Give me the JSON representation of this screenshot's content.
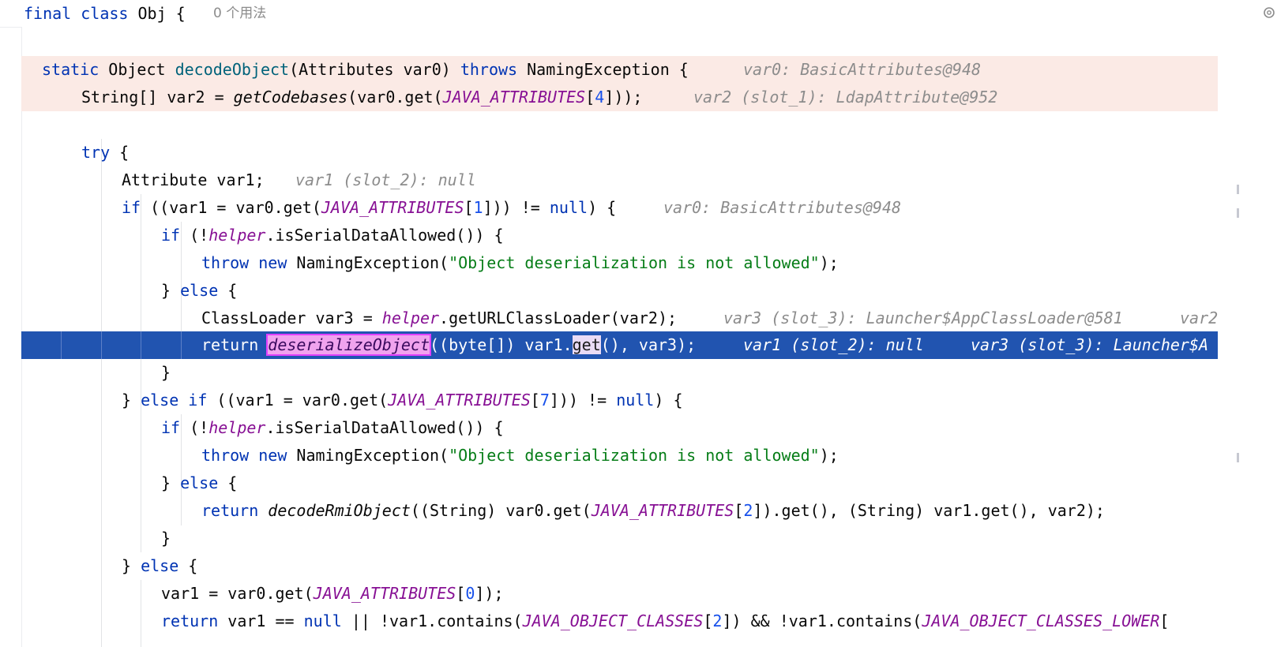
{
  "header": {
    "class_decl": "final class Obj {",
    "usages": "0 个用法"
  },
  "icons": {
    "settings": "gear-icon"
  },
  "colors": {
    "keyword": "#0033b3",
    "method_decl": "#00627a",
    "constant": "#871094",
    "number": "#1750eb",
    "string": "#067d17",
    "inlay_hint": "#8c8c8c",
    "frame_highlight": "#fbeae5",
    "execution_point": "#2154b0"
  },
  "lines": [
    {
      "id": "l1",
      "tokens": [
        {
          "t": "static",
          "c": "kw"
        },
        {
          "t": " Object ",
          "c": ""
        },
        {
          "t": "decodeObject",
          "c": "fn"
        },
        {
          "t": "(Attributes var0) ",
          "c": ""
        },
        {
          "t": "throws",
          "c": "kw"
        },
        {
          "t": " NamingException {",
          "c": ""
        }
      ],
      "hint": "var0: BasicAttributes@948"
    },
    {
      "id": "l2",
      "tokens": [
        {
          "t": "String[] var2 = ",
          "c": ""
        },
        {
          "t": "getCodebases",
          "c": "sfn"
        },
        {
          "t": "(var0.get(",
          "c": ""
        },
        {
          "t": "JAVA_ATTRIBUTES",
          "c": "cn"
        },
        {
          "t": "[",
          "c": ""
        },
        {
          "t": "4",
          "c": "num"
        },
        {
          "t": "]));",
          "c": ""
        }
      ],
      "hint": "var2 (slot_1): LdapAttribute@952"
    },
    {
      "id": "l3",
      "tokens": [
        {
          "t": "try",
          "c": "kw"
        },
        {
          "t": " {",
          "c": ""
        }
      ]
    },
    {
      "id": "l4",
      "tokens": [
        {
          "t": "Attribute var1;",
          "c": ""
        }
      ],
      "hint": "var1 (slot_2): null"
    },
    {
      "id": "l5",
      "tokens": [
        {
          "t": "if",
          "c": "kw"
        },
        {
          "t": " ((var1 = var0.get(",
          "c": ""
        },
        {
          "t": "JAVA_ATTRIBUTES",
          "c": "cn"
        },
        {
          "t": "[",
          "c": ""
        },
        {
          "t": "1",
          "c": "num"
        },
        {
          "t": "])) != ",
          "c": ""
        },
        {
          "t": "null",
          "c": "kw"
        },
        {
          "t": ") {",
          "c": ""
        }
      ],
      "hint": "var0: BasicAttributes@948"
    },
    {
      "id": "l6",
      "tokens": [
        {
          "t": "if",
          "c": "kw"
        },
        {
          "t": " (!",
          "c": ""
        },
        {
          "t": "helper",
          "c": "fld"
        },
        {
          "t": ".isSerialDataAllowed()) {",
          "c": ""
        }
      ]
    },
    {
      "id": "l7",
      "tokens": [
        {
          "t": "throw",
          "c": "kw"
        },
        {
          "t": " ",
          "c": ""
        },
        {
          "t": "new",
          "c": "kw"
        },
        {
          "t": " NamingException(",
          "c": ""
        },
        {
          "t": "\"Object deserialization is not allowed\"",
          "c": "str"
        },
        {
          "t": ");",
          "c": ""
        }
      ]
    },
    {
      "id": "l8",
      "tokens": [
        {
          "t": "} ",
          "c": ""
        },
        {
          "t": "else",
          "c": "kw"
        },
        {
          "t": " {",
          "c": ""
        }
      ]
    },
    {
      "id": "l9",
      "tokens": [
        {
          "t": "ClassLoader var3 = ",
          "c": ""
        },
        {
          "t": "helper",
          "c": "fld"
        },
        {
          "t": ".getURLClassLoader(var2);",
          "c": ""
        }
      ],
      "hint": "var3 (slot_3): Launcher$AppClassLoader@581",
      "hint2": "var2"
    },
    {
      "id": "l10",
      "tokens": [
        {
          "t": "return ",
          "c": ""
        },
        {
          "t": "deserializeObject",
          "c": "chip-pink"
        },
        {
          "t": "((byte[]) var1.",
          "c": ""
        },
        {
          "t": "get",
          "c": "chip-light"
        },
        {
          "t": "(), var3);",
          "c": ""
        }
      ],
      "hint": "var1 (slot_2): null",
      "hint2": "var3 (slot_3): Launcher$A"
    },
    {
      "id": "l11",
      "tokens": [
        {
          "t": "}",
          "c": ""
        }
      ]
    },
    {
      "id": "l12",
      "tokens": [
        {
          "t": "} ",
          "c": ""
        },
        {
          "t": "else if",
          "c": "kw"
        },
        {
          "t": " ((var1 = var0.get(",
          "c": ""
        },
        {
          "t": "JAVA_ATTRIBUTES",
          "c": "cn"
        },
        {
          "t": "[",
          "c": ""
        },
        {
          "t": "7",
          "c": "num"
        },
        {
          "t": "])) != ",
          "c": ""
        },
        {
          "t": "null",
          "c": "kw"
        },
        {
          "t": ") {",
          "c": ""
        }
      ]
    },
    {
      "id": "l13",
      "tokens": [
        {
          "t": "if",
          "c": "kw"
        },
        {
          "t": " (!",
          "c": ""
        },
        {
          "t": "helper",
          "c": "fld"
        },
        {
          "t": ".isSerialDataAllowed()) {",
          "c": ""
        }
      ]
    },
    {
      "id": "l14",
      "tokens": [
        {
          "t": "throw",
          "c": "kw"
        },
        {
          "t": " ",
          "c": ""
        },
        {
          "t": "new",
          "c": "kw"
        },
        {
          "t": " NamingException(",
          "c": ""
        },
        {
          "t": "\"Object deserialization is not allowed\"",
          "c": "str"
        },
        {
          "t": ");",
          "c": ""
        }
      ]
    },
    {
      "id": "l15",
      "tokens": [
        {
          "t": "} ",
          "c": ""
        },
        {
          "t": "else",
          "c": "kw"
        },
        {
          "t": " {",
          "c": ""
        }
      ]
    },
    {
      "id": "l16",
      "tokens": [
        {
          "t": "return ",
          "c": "kw"
        },
        {
          "t": "decodeRmiObject",
          "c": "sfn"
        },
        {
          "t": "((String) var0.get(",
          "c": ""
        },
        {
          "t": "JAVA_ATTRIBUTES",
          "c": "cn"
        },
        {
          "t": "[",
          "c": ""
        },
        {
          "t": "2",
          "c": "num"
        },
        {
          "t": "]).get(), (String) var1.get(), var2);",
          "c": ""
        }
      ]
    },
    {
      "id": "l17",
      "tokens": [
        {
          "t": "}",
          "c": ""
        }
      ]
    },
    {
      "id": "l18",
      "tokens": [
        {
          "t": "} ",
          "c": ""
        },
        {
          "t": "else",
          "c": "kw"
        },
        {
          "t": " {",
          "c": ""
        }
      ]
    },
    {
      "id": "l19",
      "tokens": [
        {
          "t": "var1 = var0.get(",
          "c": ""
        },
        {
          "t": "JAVA_ATTRIBUTES",
          "c": "cn"
        },
        {
          "t": "[",
          "c": ""
        },
        {
          "t": "0",
          "c": "num"
        },
        {
          "t": "]);",
          "c": ""
        }
      ]
    },
    {
      "id": "l20",
      "tokens": [
        {
          "t": "return",
          "c": "kw"
        },
        {
          "t": " var1 == ",
          "c": ""
        },
        {
          "t": "null",
          "c": "kw"
        },
        {
          "t": " || !var1.contains(",
          "c": ""
        },
        {
          "t": "JAVA_OBJECT_CLASSES",
          "c": "cn"
        },
        {
          "t": "[",
          "c": ""
        },
        {
          "t": "2",
          "c": "num"
        },
        {
          "t": "]) && !var1.contains(",
          "c": ""
        },
        {
          "t": "JAVA_OBJECT_CLASSES_LOWER",
          "c": "cn"
        },
        {
          "t": "[",
          "c": ""
        }
      ]
    }
  ]
}
